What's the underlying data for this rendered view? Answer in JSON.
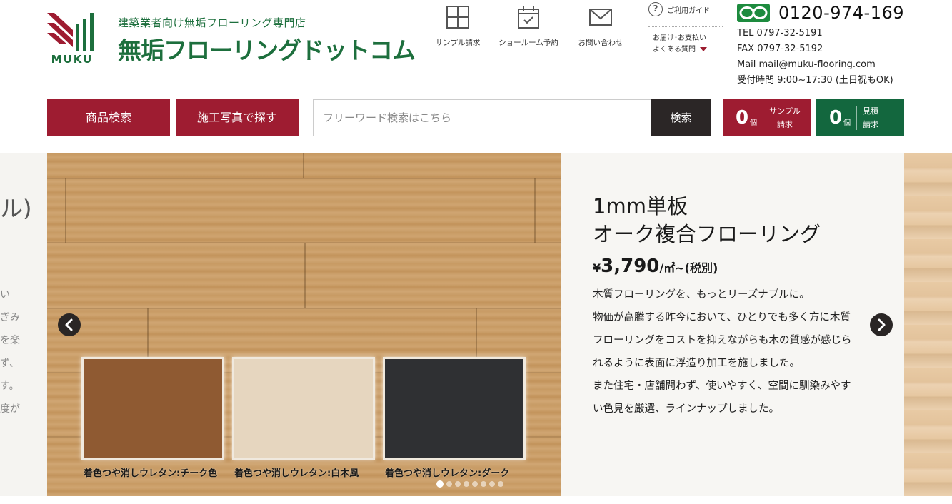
{
  "header": {
    "logo_text": "MUKU",
    "tagline": "建築業者向け無垢フローリング専門店",
    "site_name": "無垢フローリングドットコム",
    "nav": [
      {
        "label": "サンプル請求",
        "icon": "grid-icon"
      },
      {
        "label": "ショールーム予約",
        "icon": "calendar-check-icon"
      },
      {
        "label": "お問い合わせ",
        "icon": "mail-icon"
      }
    ],
    "guide": {
      "label": "ご利用ガイド",
      "q_mark": "?",
      "line1": "お届け･お支払い",
      "line2": "よくある質問"
    },
    "contact": {
      "freedial": "0120-974-169",
      "tel": "TEL 0797-32-5191",
      "fax": "FAX 0797-32-5192",
      "mail": "Mail mail@muku-flooring.com",
      "hours": "受付時間 9:00~17:30 (土日祝もOK)"
    }
  },
  "search": {
    "product_search_label": "商品検索",
    "photo_search_label": "施工写真で探す",
    "placeholder": "フリーワード検索はこちら",
    "value": "",
    "submit_label": "検索"
  },
  "carts": {
    "sample": {
      "count": "0",
      "unit": "個",
      "line1": "サンプル",
      "line2": "請求"
    },
    "quote": {
      "count": "0",
      "unit": "個",
      "line1": "見積",
      "line2": "請求"
    }
  },
  "hero": {
    "peek_left": {
      "heading": "ル)",
      "lines": [
        "い",
        "ぎみ",
        "を楽",
        "ず、",
        "す。",
        "度が"
      ]
    },
    "title_line1": "1mm単板",
    "title_line2": "オーク複合フローリング",
    "price": {
      "currency": "¥",
      "amount": "3,790",
      "unit": "/㎡~(税別)"
    },
    "description": [
      "木質フローリングを、もっとリーズナブルに。",
      "物価が高騰する昨今において、ひとりでも多く方に木質",
      "フローリングをコストを抑えながらも木の質感が感じら",
      "れるように表面に浮造り加工を施しました。",
      "また住宅・店舗問わず、使いやすく、空間に馴染みやす",
      "い色見を厳選、ラインナップしました。"
    ],
    "swatches": [
      {
        "label": "着色つや消しウレタン:チーク色",
        "color": "#8f5a32"
      },
      {
        "label": "着色つや消しウレタン:白木風",
        "color": "#e6d6bf"
      },
      {
        "label": "着色つや消しウレタン:ダーク",
        "color": "#2f3033"
      }
    ],
    "slide_count": 8,
    "active_slide": 1
  },
  "colors": {
    "brand_green": "#1d6f3d",
    "brand_red": "#9e1c31",
    "dark_button": "#2b2626",
    "quote_green": "#13673e",
    "freedial_green": "#1d8b3e"
  }
}
